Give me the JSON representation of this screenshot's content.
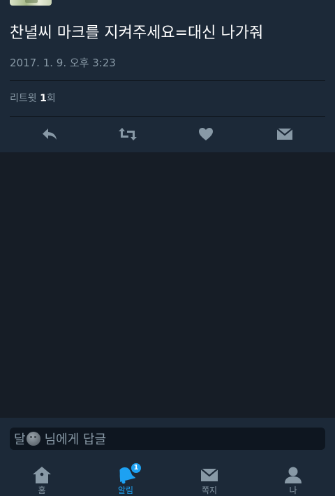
{
  "tweet": {
    "text": "찬녈씨 마크를 지켜주세요=대신 나가줘",
    "timestamp": "2017. 1. 9. 오후 3:23",
    "retweet_label": "리트윗",
    "retweet_count": "1",
    "retweet_unit": "회"
  },
  "actions": {
    "reply_icon": "reply-icon",
    "retweet_icon": "retweet-icon",
    "like_icon": "heart-icon",
    "dm_icon": "envelope-icon"
  },
  "reply_bar": {
    "name_prefix": "달",
    "emoji": "new-moon-face",
    "placeholder": "님에게 답글"
  },
  "tabbar": {
    "tabs": [
      {
        "label": "홈",
        "icon": "home-icon"
      },
      {
        "label": "알림",
        "icon": "bell-icon",
        "badge": "1",
        "active": true
      },
      {
        "label": "쪽지",
        "icon": "envelope-icon"
      },
      {
        "label": "나",
        "icon": "person-icon"
      }
    ]
  },
  "colors": {
    "card_bg": "#1c2938",
    "page_bg": "#161d26",
    "secondary_text": "#8899a6",
    "accent": "#1da1f2"
  }
}
